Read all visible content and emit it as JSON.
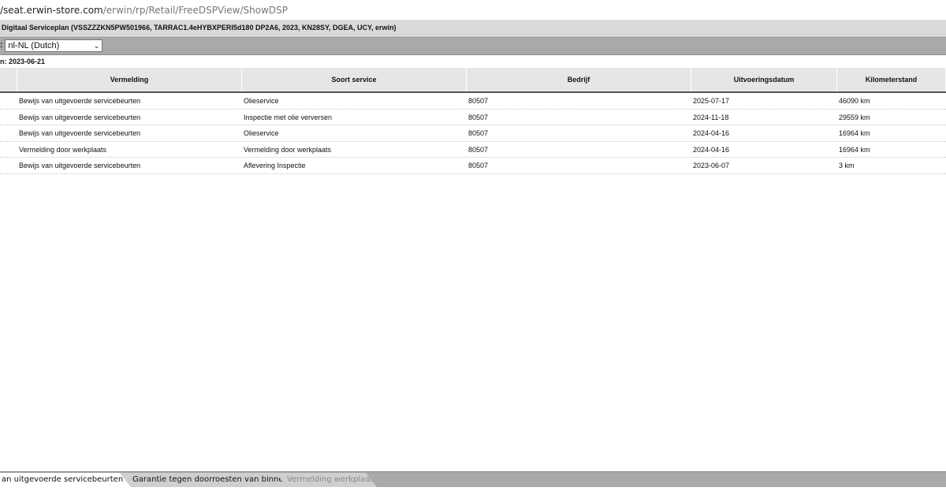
{
  "browser": {
    "url_host": "/seat.erwin-store.com",
    "url_path": "/erwin/rp/Retail/FreeDSPView/ShowDSP"
  },
  "title": "Digitaal Serviceplan (VSSZZZKN5PW501966, TARRAC1.4eHYBXPERI5d180 DP2A6, 2023, KN28SY, DGEA, UCY, erwin)",
  "language": {
    "label": ":",
    "selected": "nl-NL (Dutch)"
  },
  "date_line": "n: 2023-06-21",
  "table": {
    "headers": [
      "Vermelding",
      "Soort service",
      "Bedrijf",
      "Uitvoeringsdatum",
      "Kilometerstand"
    ],
    "rows": [
      [
        "Bewijs van uitgevoerde servicebeurten",
        "Olieservice",
        "80507",
        "2025-07-17",
        "46090 km"
      ],
      [
        "Bewijs van uitgevoerde servicebeurten",
        "Inspectie met olie verversen",
        "80507",
        "2024-11-18",
        "29559 km"
      ],
      [
        "Bewijs van uitgevoerde servicebeurten",
        "Olieservice",
        "80507",
        "2024-04-16",
        "16964 km"
      ],
      [
        "Vermelding door werkplaats",
        "Vermelding door werkplaats",
        "80507",
        "2024-04-16",
        "16964 km"
      ],
      [
        "Bewijs van uitgevoerde servicebeurten",
        "Aflevering Inspectie",
        "80507",
        "2023-06-07",
        "3 km"
      ]
    ]
  },
  "tabs": [
    "an uitgevoerde servicebeurten (OT)",
    "Garantie tegen doorroesten van binnenuit",
    "Vermelding werkplaats"
  ]
}
